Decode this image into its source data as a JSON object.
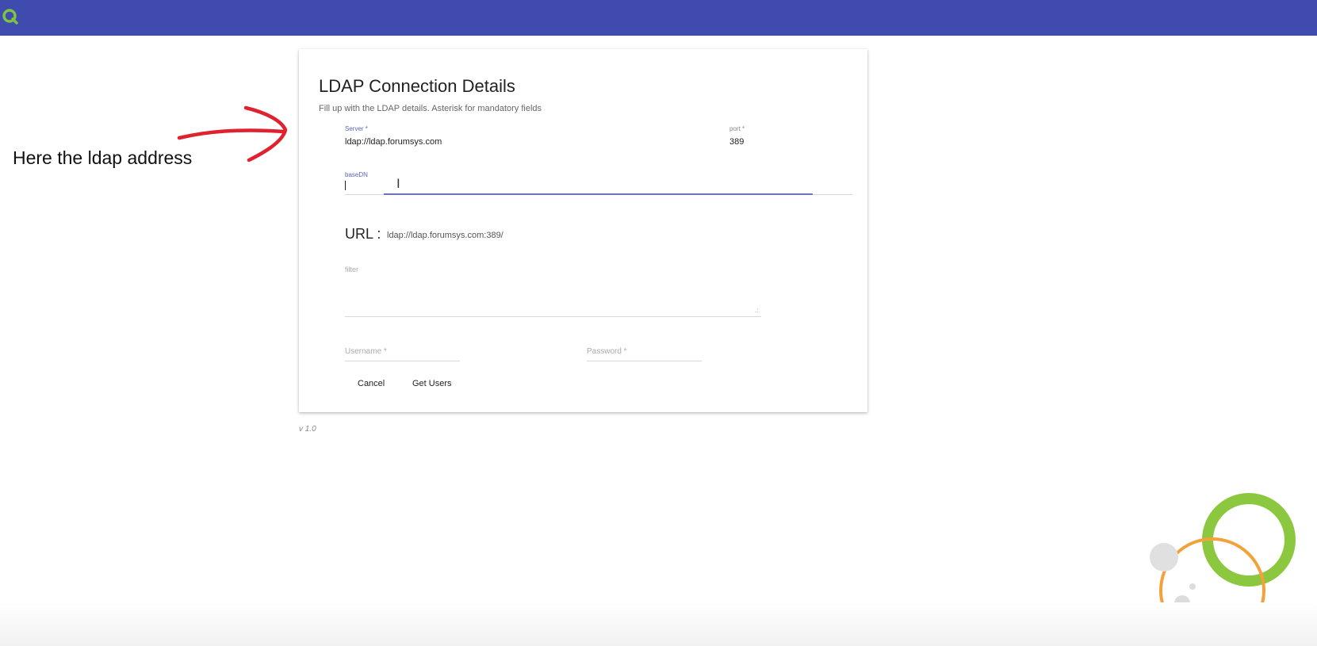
{
  "app": {
    "logo_icon": "qlik-q-icon",
    "brand_color": "#3f4bae"
  },
  "annotation": {
    "text": "Here the ldap address",
    "arrow_icon": "red-arrow-icon",
    "arrow_color": "#e0212e"
  },
  "form": {
    "title": "LDAP Connection Details",
    "subtitle": "Fill up with the LDAP details. Asterisk for mandatory fields",
    "server": {
      "label": "Server *",
      "value": "ldap://ldap.forumsys.com"
    },
    "port": {
      "label": "port *",
      "value": "389"
    },
    "basedn": {
      "label": "baseDN",
      "value": ""
    },
    "url": {
      "label": "URL :",
      "value": "ldap://ldap.forumsys.com:389/"
    },
    "filter": {
      "placeholder": "filter"
    },
    "username": {
      "placeholder": "Username *"
    },
    "password": {
      "placeholder": "Password *"
    },
    "cancel_label": "Cancel",
    "get_users_label": "Get Users"
  },
  "footer": {
    "version": "v 1.0"
  }
}
